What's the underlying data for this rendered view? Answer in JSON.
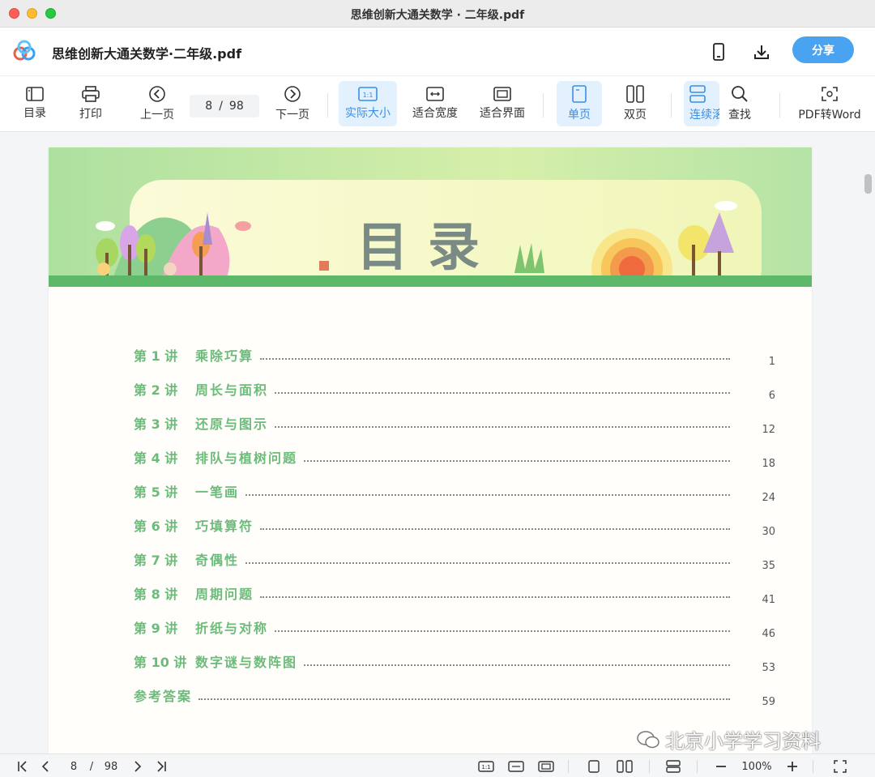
{
  "window": {
    "title": "思维创新大通关数学 · 二年级.pdf"
  },
  "header": {
    "doc_title": "思维创新大通关数学·二年级.pdf",
    "share_label": "分享",
    "icons": [
      "app-logo",
      "phone-icon",
      "download-icon"
    ]
  },
  "toolbar": {
    "toc_label": "目录",
    "print_label": "打印",
    "prev_label": "上一页",
    "current_page": "8",
    "page_sep": "/",
    "total_pages": "98",
    "next_label": "下一页",
    "actual_size_label": "实际大小",
    "fit_width_label": "适合宽度",
    "fit_page_label": "适合界面",
    "single_label": "单页",
    "double_label": "双页",
    "continuous_label": "连续滚",
    "find_label": "查找",
    "pdf_word_label": "PDF转Word",
    "actual_size_icon_text": "1:1"
  },
  "document": {
    "heading": "目录",
    "toc": [
      {
        "num": "第 1 讲",
        "name": "乘除巧算",
        "page": "1"
      },
      {
        "num": "第 2 讲",
        "name": "周长与面积",
        "page": "6"
      },
      {
        "num": "第 3 讲",
        "name": "还原与图示",
        "page": "12"
      },
      {
        "num": "第 4 讲",
        "name": "排队与植树问题",
        "page": "18"
      },
      {
        "num": "第 5 讲",
        "name": "一笔画",
        "page": "24"
      },
      {
        "num": "第 6 讲",
        "name": "巧填算符",
        "page": "30"
      },
      {
        "num": "第 7 讲",
        "name": "奇偶性",
        "page": "35"
      },
      {
        "num": "第 8 讲",
        "name": "周期问题",
        "page": "41"
      },
      {
        "num": "第 9 讲",
        "name": "折纸与对称",
        "page": "46"
      },
      {
        "num": "第 10 讲",
        "name": "数字谜与数阵图",
        "page": "53"
      },
      {
        "num": "",
        "name": "参考答案",
        "page": "59"
      }
    ],
    "watermark": "北京小学学习资料"
  },
  "statusbar": {
    "current_page": "8",
    "sep": "/",
    "total_pages": "98",
    "zoom": "100%",
    "actual_size_icon_text": "1:1"
  },
  "colors": {
    "accent": "#4aa3f0",
    "active_bg": "#e3f0fd",
    "toc_green": "#6dbb7a"
  }
}
